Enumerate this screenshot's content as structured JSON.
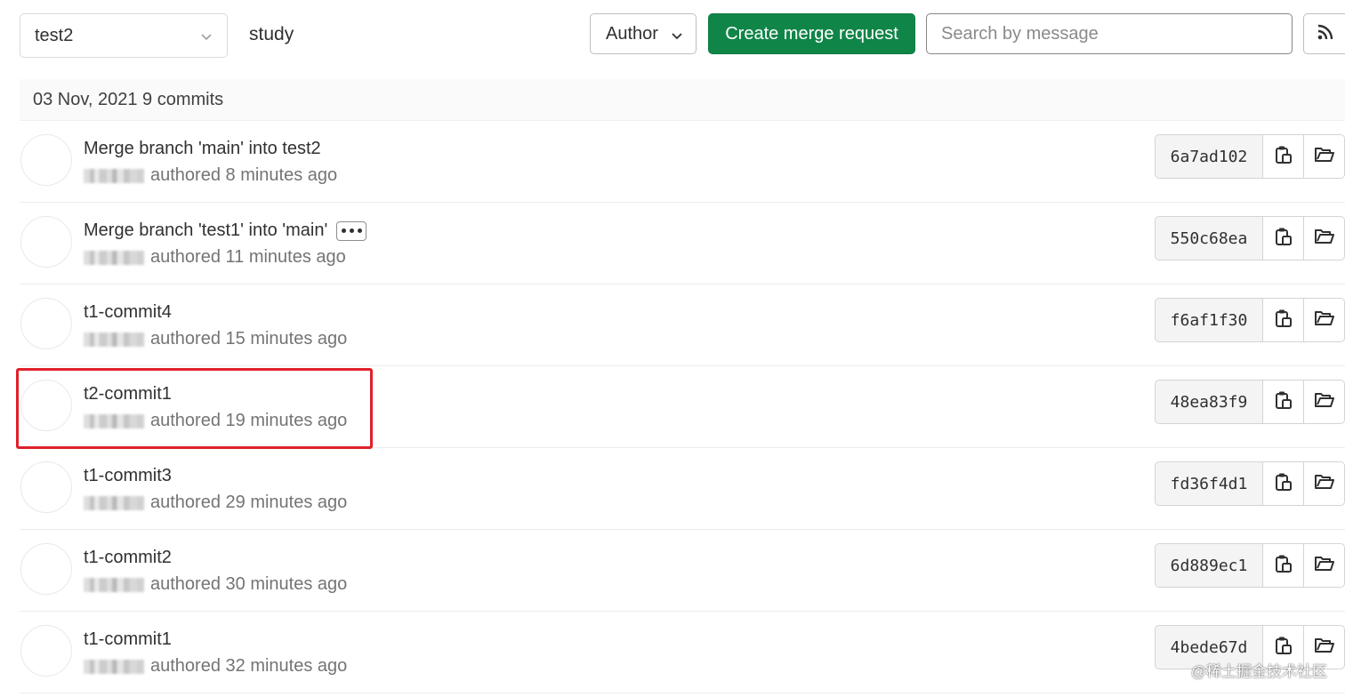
{
  "toolbar": {
    "branch": "test2",
    "project": "study",
    "author_label": "Author",
    "create_mr_label": "Create merge request",
    "search_placeholder": "Search by message",
    "rss_icon": "rss-icon"
  },
  "day_group": {
    "header": "03 Nov, 2021 9 commits"
  },
  "commits": [
    {
      "title": "Merge branch 'main' into test2",
      "meta": "authored 8 minutes ago",
      "sha": "6a7ad102",
      "has_ellipsis": false
    },
    {
      "title": "Merge branch 'test1' into 'main'",
      "meta": "authored 11 minutes ago",
      "sha": "550c68ea",
      "has_ellipsis": true
    },
    {
      "title": "t1-commit4",
      "meta": "authored 15 minutes ago",
      "sha": "f6af1f30",
      "has_ellipsis": false
    },
    {
      "title": "t2-commit1",
      "meta": "authored 19 minutes ago",
      "sha": "48ea83f9",
      "has_ellipsis": false
    },
    {
      "title": "t1-commit3",
      "meta": "authored 29 minutes ago",
      "sha": "fd36f4d1",
      "has_ellipsis": false
    },
    {
      "title": "t1-commit2",
      "meta": "authored 30 minutes ago",
      "sha": "6d889ec1",
      "has_ellipsis": false
    },
    {
      "title": "t1-commit1",
      "meta": "authored 32 minutes ago",
      "sha": "4bede67d",
      "has_ellipsis": false
    }
  ],
  "annotation": {
    "highlight_color": "#e0202a"
  },
  "watermark": "@稀土掘金技术社区",
  "colors": {
    "primary_green": "#108548"
  }
}
